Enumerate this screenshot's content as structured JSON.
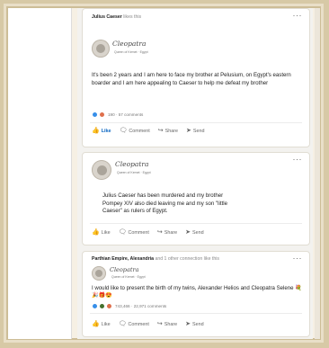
{
  "post1": {
    "actor": "Julius Caeser",
    "activity": "likes this",
    "brand": "Cleopatra",
    "brand_sub": "Queen of Kemet · Egypt",
    "text": "It's been 2 years and I am here to face my brother at Pelusium, on Egypt's eastern boarder and I am here appealing to Caeser to help me defeat my brother",
    "reactions": "190 · 57 comments",
    "actions": {
      "like": "Like",
      "comment": "Comment",
      "share": "Share",
      "send": "Send"
    }
  },
  "post2": {
    "brand": "Cleopatra",
    "brand_sub": "Queen of Kemet · Egypt",
    "text": "Julius Caeser has been murdered and my brother Pompey XIV also died leaving me and my son \"little Caeser\" as rulers of Egypt.",
    "actions": {
      "like": "Like",
      "comment": "Comment",
      "share": "Share",
      "send": "Send"
    }
  },
  "post3": {
    "actor": "Parthian Empire, Alexandria",
    "activity": "and 1 other connection like this",
    "brand": "Cleopatra",
    "brand_sub": "Queen of Kemet · Egypt",
    "text": "I would like to present the birth of my twins, Alexander Helios and Cleopatra Selene",
    "emoji": "💐🎉🎁😍",
    "reactions": "743,466 · 22,971 comments",
    "actions": {
      "like": "Like",
      "comment": "Comment",
      "share": "Share",
      "send": "Send"
    }
  },
  "more_glyph": "···",
  "colors": {
    "accent": "#0a66c2",
    "frame": "#d7c9a6"
  }
}
